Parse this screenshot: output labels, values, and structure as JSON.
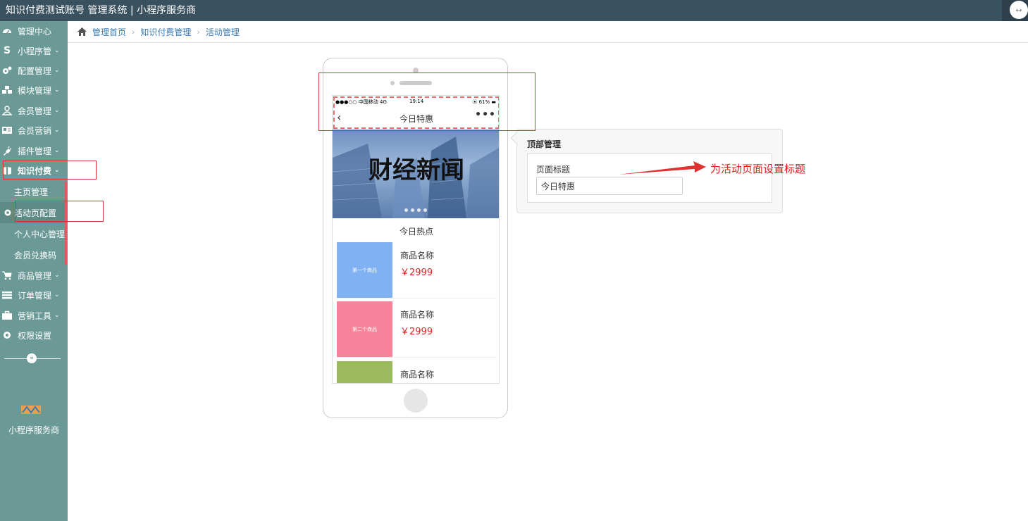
{
  "header": {
    "title": "知识付费测试账号 管理系统 | 小程序服务商",
    "avatar_glyph": "↔"
  },
  "sidebar": {
    "items": [
      {
        "label": "管理中心",
        "icon": "dashboard-icon",
        "chevron": ""
      },
      {
        "label": "小程序管",
        "icon": "s-logo-icon",
        "chevron": "⌄"
      },
      {
        "label": "配置管理",
        "icon": "gears-icon",
        "chevron": "⌄"
      },
      {
        "label": "模块管理",
        "icon": "cubes-icon",
        "chevron": "⌄"
      },
      {
        "label": "会员管理",
        "icon": "user-icon",
        "chevron": "⌄"
      },
      {
        "label": "会员营销",
        "icon": "id-card-icon",
        "chevron": "⌄"
      },
      {
        "label": "插件管理",
        "icon": "plug-icon",
        "chevron": "⌄"
      },
      {
        "label": "知识付费",
        "icon": "book-icon",
        "chevron": "⌄"
      }
    ],
    "sub_items": [
      {
        "label": "主页管理"
      },
      {
        "label": "活动页配置"
      },
      {
        "label": "个人中心管理"
      },
      {
        "label": "会员兑换码"
      }
    ],
    "items_after": [
      {
        "label": "商品管理",
        "icon": "cart-icon",
        "chevron": "⌄"
      },
      {
        "label": "订单管理",
        "icon": "list-icon",
        "chevron": "⌄"
      },
      {
        "label": "营销工具",
        "icon": "briefcase-icon",
        "chevron": "⌄"
      },
      {
        "label": "权限设置",
        "icon": "gear-icon",
        "chevron": ""
      }
    ],
    "collapse_glyph": "«",
    "brand": "小程序服务商"
  },
  "breadcrumb": [
    "管理首页",
    "知识付费管理",
    "活动管理"
  ],
  "phone": {
    "status_left": "●●●○○ 中国移动  4G",
    "status_time": "19:14",
    "status_right": "⦿ 61% ▬",
    "nav_back": "‹",
    "nav_title": "今日特惠",
    "nav_more": "•••",
    "banner_text": "财经新闻",
    "section_title": "今日热点",
    "products": [
      {
        "img_text": "第一个商品",
        "name": "商品名称",
        "price": "￥2999",
        "color": "#7fb1f3"
      },
      {
        "img_text": "第二个商品",
        "name": "商品名称",
        "price": "￥2999",
        "color": "#f7849a"
      },
      {
        "img_text": "",
        "name": "商品名称",
        "price": "",
        "color": "#9aba5c"
      }
    ]
  },
  "popover": {
    "heading": "顶部管理",
    "field_label": "页面标题",
    "field_value": "今日特惠"
  },
  "annotation": {
    "note": "为活动页面设置标题"
  }
}
